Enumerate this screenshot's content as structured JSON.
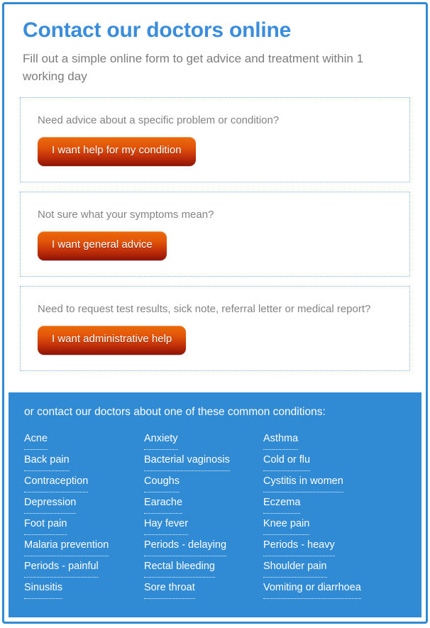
{
  "header": {
    "title": "Contact our doctors online",
    "subtitle": "Fill out a simple online form to get advice and treatment within 1 working day"
  },
  "options": [
    {
      "prompt": "Need advice about a specific problem or condition?",
      "button_label": "I want help for my condition"
    },
    {
      "prompt": "Not sure what your symptoms mean?",
      "button_label": "I want general advice"
    },
    {
      "prompt": "Need to request test results, sick note, referral letter or medical report?",
      "button_label": "I want administrative help"
    }
  ],
  "conditions": {
    "heading": "or contact our doctors about one of these common conditions:",
    "items": [
      "Acne",
      "Anxiety",
      "Asthma",
      "Back pain",
      "Bacterial vaginosis",
      "Cold or flu",
      "Contraception",
      "Coughs",
      "Cystitis in women",
      "Depression",
      "Earache",
      "Eczema",
      "Foot pain",
      "Hay fever",
      "Knee pain",
      "Malaria prevention",
      "Periods - delaying",
      "Periods - heavy",
      "Periods - painful",
      "Rectal bleeding",
      "Shoulder pain",
      "Sinusitis",
      "Sore throat",
      "Vomiting or diarrhoea"
    ]
  },
  "colors": {
    "brand_blue": "#3a8ddd",
    "panel_blue": "#308ad4",
    "border_blue": "#2f8bd6",
    "card_border": "#7fb8e8",
    "prompt_gray": "#848484",
    "button_top": "#ec6a0b",
    "button_bottom": "#8d1205"
  }
}
